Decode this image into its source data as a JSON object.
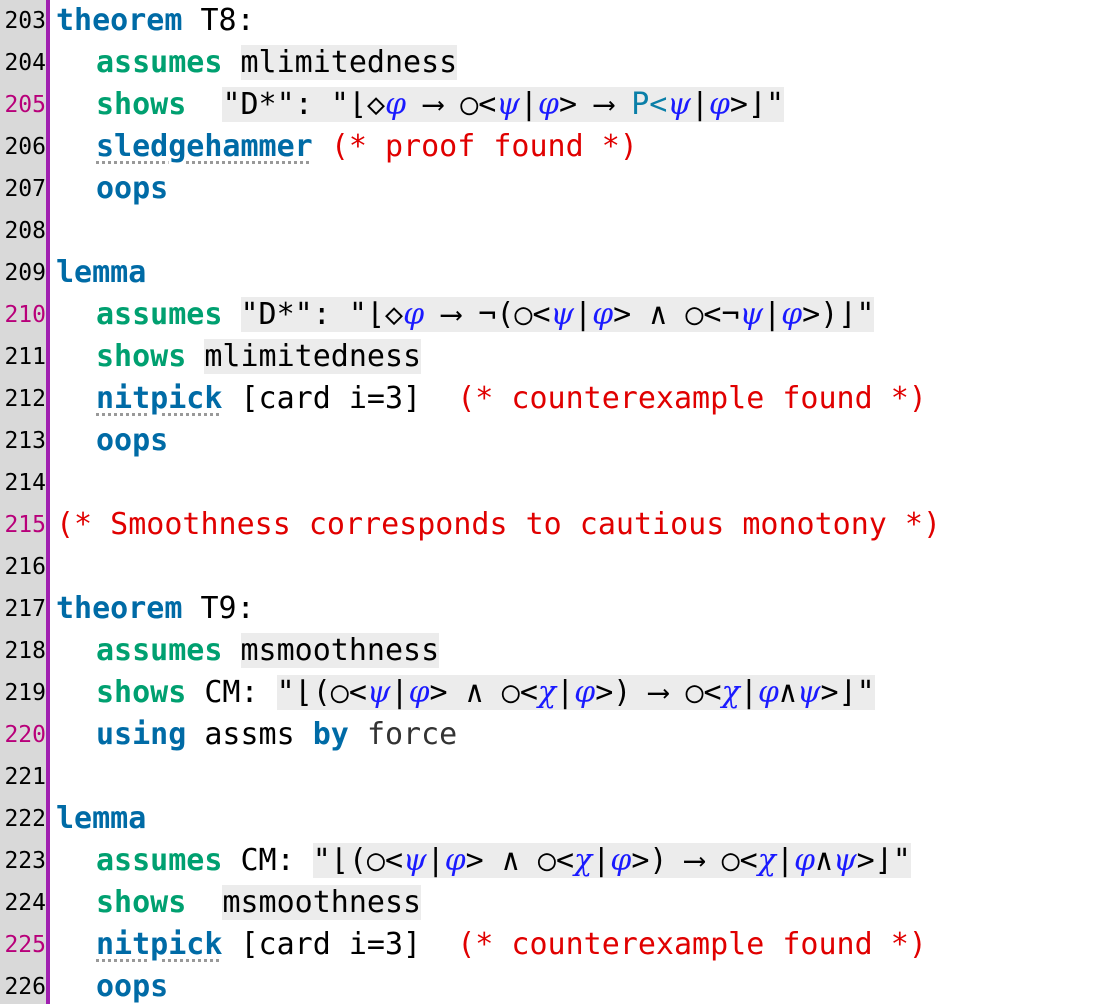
{
  "line_numbers": [
    "203",
    "204",
    "205",
    "206",
    "207",
    "208",
    "209",
    "210",
    "211",
    "212",
    "213",
    "214",
    "215",
    "216",
    "217",
    "218",
    "219",
    "220",
    "221",
    "222",
    "223",
    "224",
    "225",
    "226"
  ],
  "tokens": {
    "theorem": "theorem",
    "lemma": "lemma",
    "assumes": "assumes",
    "shows": "shows",
    "sledgehammer": "sledgehammer",
    "nitpick": "nitpick",
    "oops": "oops",
    "using": "using",
    "by": "by",
    "t8": " T8:",
    "t9": " T9:",
    "mlimitedness": "mlimitedness",
    "msmoothness": "msmoothness",
    "dstar": "\"D*\"",
    "colon": ":",
    "cm": "CM:",
    "quote_open": "\"⌊",
    "quote_close": "⌋\"",
    "phi": "φ",
    "psi": "ψ",
    "chi": "χ",
    "diamond": "◇",
    "arrow": " ⟶ ",
    "circ_lt": "○<",
    "bar": "|",
    "gt": ">",
    "gt_space": "> ",
    "P_lt": "P<",
    "not_paren_circ": "¬(○<",
    "and_circ_not": " ∧ ○<¬",
    "gt_paren": ">)",
    "paren_circ": "(○<",
    "and_circ": " ∧ ○<",
    "wedge": "∧",
    "card": "[card i=3]",
    "assms": "assms",
    "force": "force",
    "proof_found": "(* proof found *)",
    "counterexample_found": "(* counterexample found *)",
    "smoothness_comment": "(* Smoothness corresponds to cautious monotony *)"
  },
  "marked_lines": [
    "205",
    "210",
    "215",
    "220",
    "225"
  ],
  "colors": {
    "keyword_blue": "#006ba6",
    "keyword_green": "#00a070",
    "comment_red": "#e00000",
    "variable_blue": "#1a1aff",
    "gutter_bar": "#a020b0",
    "gutter_bg": "#d9d9d9",
    "marked_line_number": "#b8007a"
  }
}
